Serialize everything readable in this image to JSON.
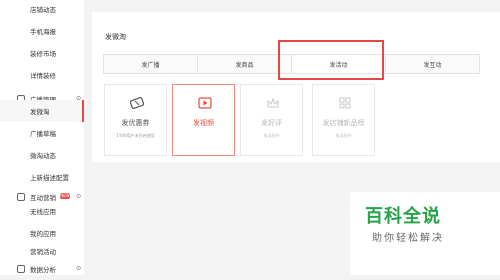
{
  "sidebar": {
    "items": [
      {
        "label": "店铺动态",
        "type": "item"
      },
      {
        "label": "手机海报",
        "type": "item"
      },
      {
        "label": "装修市场",
        "type": "item"
      },
      {
        "label": "详情装修",
        "type": "item"
      },
      {
        "label": "广播管理",
        "type": "section"
      },
      {
        "label": "发微淘",
        "type": "item",
        "active": true
      },
      {
        "label": "广播草稿",
        "type": "item"
      },
      {
        "label": "微淘动态",
        "type": "item"
      },
      {
        "label": "上新描述配置",
        "type": "item"
      },
      {
        "label": "互动营销",
        "type": "section",
        "badge": "NEW"
      },
      {
        "label": "无线应用",
        "type": "item"
      },
      {
        "label": "我的应用",
        "type": "item"
      },
      {
        "label": "营销活动",
        "type": "item"
      },
      {
        "label": "数据分析",
        "type": "section"
      }
    ]
  },
  "main": {
    "title": "发微淘",
    "tabs": [
      {
        "label": "发广播"
      },
      {
        "label": "发商品"
      },
      {
        "label": "发活动",
        "active": true
      },
      {
        "label": "发互动"
      }
    ],
    "features": [
      {
        "label": "发优惠券",
        "sub": "1%的用户未开启使用",
        "icon": "ticket-icon",
        "state": "normal"
      },
      {
        "label": "发视频",
        "sub": "",
        "icon": "play-icon",
        "state": "selected"
      },
      {
        "label": "发好评",
        "sub": "敬请期待",
        "icon": "crown-icon",
        "state": "disabled"
      },
      {
        "label": "发店铺新品榜",
        "sub": "敬请期待",
        "icon": "grid-icon",
        "state": "disabled"
      }
    ]
  },
  "watermark": {
    "title": "百科全说",
    "subtitle": "助你轻松解决"
  },
  "colors": {
    "accent": "#e84545",
    "watermark_green": "#25a447"
  }
}
